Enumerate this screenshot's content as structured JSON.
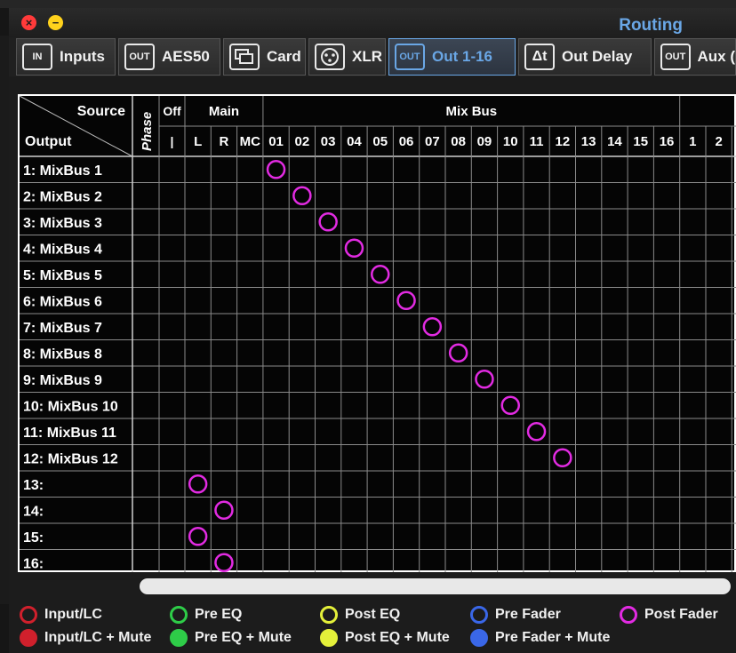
{
  "window": {
    "title": "Routing"
  },
  "tabs": [
    {
      "label": "Inputs",
      "icon": "in-icon",
      "icon_text": "IN"
    },
    {
      "label": "AES50",
      "icon": "out-icon",
      "icon_text": "OUT"
    },
    {
      "label": "Card",
      "icon": "card-icon",
      "icon_text": ""
    },
    {
      "label": "XLR",
      "icon": "xlr-icon",
      "icon_text": ""
    },
    {
      "label": "Out 1-16",
      "icon": "out-icon",
      "icon_text": "OUT"
    },
    {
      "label": "Out Delay",
      "icon": "delta-t-icon",
      "icon_text": "Δt"
    },
    {
      "label": "Aux (",
      "icon": "out-icon",
      "icon_text": "OUT"
    }
  ],
  "active_tab": 4,
  "matrix": {
    "corner_source": "Source",
    "corner_output": "Output",
    "phase_label": "Phase",
    "off_label": "Off",
    "off_sub": "|",
    "main_label": "Main",
    "main_cols": [
      "L",
      "R",
      "MC"
    ],
    "mixbus_label": "Mix Bus",
    "mixbus_cols": [
      "01",
      "02",
      "03",
      "04",
      "05",
      "06",
      "07",
      "08",
      "09",
      "10",
      "11",
      "12",
      "13",
      "14",
      "15",
      "16"
    ],
    "extra_cols": [
      "1",
      "2"
    ],
    "rows": [
      "1: MixBus 1",
      "2: MixBus 2",
      "3: MixBus 3",
      "4: MixBus 4",
      "5: MixBus 5",
      "6: MixBus 6",
      "7: MixBus 7",
      "8: MixBus 8",
      "9: MixBus 9",
      "10: MixBus 10",
      "11: MixBus 11",
      "12: MixBus 12",
      "13:",
      "14:",
      "15:",
      "16:"
    ],
    "routes": [
      {
        "row": 0,
        "col": "01"
      },
      {
        "row": 1,
        "col": "02"
      },
      {
        "row": 2,
        "col": "03"
      },
      {
        "row": 3,
        "col": "04"
      },
      {
        "row": 4,
        "col": "05"
      },
      {
        "row": 5,
        "col": "06"
      },
      {
        "row": 6,
        "col": "07"
      },
      {
        "row": 7,
        "col": "08"
      },
      {
        "row": 8,
        "col": "09"
      },
      {
        "row": 9,
        "col": "10"
      },
      {
        "row": 10,
        "col": "11"
      },
      {
        "row": 11,
        "col": "12"
      },
      {
        "row": 12,
        "col": "L"
      },
      {
        "row": 13,
        "col": "R"
      },
      {
        "row": 14,
        "col": "L"
      },
      {
        "row": 15,
        "col": "R"
      }
    ],
    "route_color": "#e22be2"
  },
  "legend": [
    {
      "label": "Input/LC",
      "color": "#d0202c",
      "filled": false
    },
    {
      "label": "Pre EQ",
      "color": "#2ecc48",
      "filled": false
    },
    {
      "label": "Post EQ",
      "color": "#e4f03a",
      "filled": false
    },
    {
      "label": "Pre Fader",
      "color": "#3a67e8",
      "filled": false
    },
    {
      "label": "Post Fader",
      "color": "#e22be2",
      "filled": false
    },
    {
      "label": "Input/LC + Mute",
      "color": "#d0202c",
      "filled": true
    },
    {
      "label": "Pre EQ + Mute",
      "color": "#2ecc48",
      "filled": true
    },
    {
      "label": "Post EQ + Mute",
      "color": "#e4f03a",
      "filled": true
    },
    {
      "label": "Pre Fader + Mute",
      "color": "#3a67e8",
      "filled": true
    }
  ]
}
